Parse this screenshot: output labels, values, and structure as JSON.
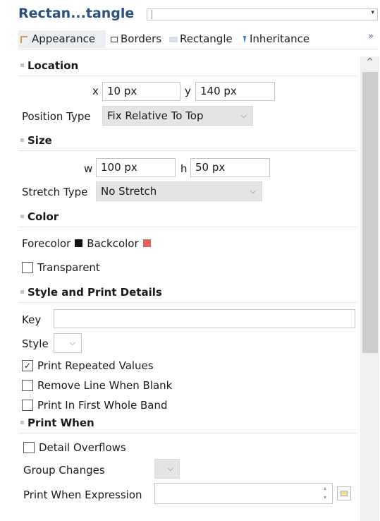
{
  "header": {
    "title": "Rectan...tangle"
  },
  "tabs": [
    {
      "label": "Appearance",
      "active": true,
      "icon": "appearance-icon"
    },
    {
      "label": "Borders",
      "icon": "borders-icon"
    },
    {
      "label": "Rectangle",
      "icon": "rectangle-icon"
    },
    {
      "label": "Inheritance",
      "icon": "inheritance-icon"
    }
  ],
  "tabs_more": "»",
  "scroll": {
    "up_arrow": "^"
  },
  "location": {
    "title": "Location",
    "x_label": "x",
    "x_value": "10 px",
    "y_label": "y",
    "y_value": "140 px",
    "position_type_label": "Position Type",
    "position_type_value": "Fix Relative To Top"
  },
  "size": {
    "title": "Size",
    "w_label": "w",
    "w_value": "100 px",
    "h_label": "h",
    "h_value": "50 px",
    "stretch_type_label": "Stretch Type",
    "stretch_type_value": "No Stretch"
  },
  "color": {
    "title": "Color",
    "forecolor_label": "Forecolor",
    "forecolor": "#111111",
    "backcolor_label": "Backcolor",
    "backcolor": "#e06060",
    "transparent_label": "Transparent",
    "transparent_checked": false
  },
  "style_print": {
    "title": "Style and Print Details",
    "key_label": "Key",
    "key_value": "",
    "style_label": "Style",
    "style_value": "",
    "print_repeated_label": "Print Repeated Values",
    "print_repeated_checked": true,
    "remove_line_label": "Remove Line When Blank",
    "remove_line_checked": false,
    "print_first_band_label": "Print In First Whole Band",
    "print_first_band_checked": false
  },
  "print_when": {
    "title": "Print When",
    "detail_overflows_label": "Detail Overflows",
    "detail_overflows_checked": false,
    "group_changes_label": "Group Changes",
    "group_changes_value": "",
    "expression_label": "Print When Expression",
    "expression_value": ""
  },
  "glyphs": {
    "chevron": "⌵",
    "check": "✓",
    "dropdown_arrow": "▾"
  }
}
